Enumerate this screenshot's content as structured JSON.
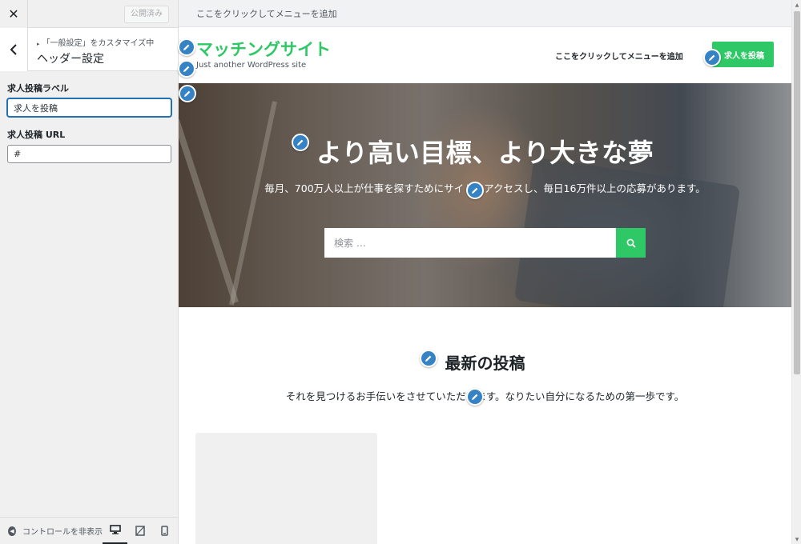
{
  "sidebar": {
    "close_icon": "close-icon",
    "published_label": "公開済み",
    "breadcrumb": "「一般設定」をカスタマイズ中",
    "section_title": "ヘッダー設定",
    "fields": [
      {
        "label": "求人投稿ラベル",
        "value": "求人を投稿"
      },
      {
        "label": "求人投稿 URL",
        "value": "#"
      }
    ],
    "hide_controls_label": "コントロールを非表示",
    "devices": [
      "desktop-icon",
      "tablet-icon",
      "mobile-icon"
    ]
  },
  "preview": {
    "menu_placeholder": "ここをクリックしてメニューを追加",
    "site_title": "マッチングサイト",
    "site_tagline": "Just another WordPress site",
    "header_menu_link": "ここをクリックしてメニューを追加",
    "post_job_button": "求人を投稿",
    "hero": {
      "title": "より高い目標、より大きな夢",
      "subtitle": "毎月、700万人以上が仕事を探すためにサイトにアクセスし、毎日16万件以上の応募があります。",
      "search_placeholder": "検索 …"
    },
    "latest": {
      "title": "最新の投稿",
      "subtitle": "それを見つけるお手伝いをさせていただきます。なりたい自分になるための第一歩です。"
    }
  },
  "colors": {
    "accent_green": "#2ec866",
    "edit_pencil_blue": "#3582c4",
    "focus_blue": "#2271b1"
  }
}
